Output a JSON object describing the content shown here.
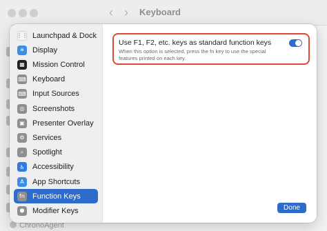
{
  "window": {
    "title": "Keyboard",
    "back_glyph": "‹",
    "forward_glyph": "›",
    "footer_text": "ChronoAgent"
  },
  "sidebar": {
    "items": [
      {
        "label": "Launchpad & Dock",
        "icon": "launchpad-icon",
        "color": "#f4f4f4",
        "glyph": "⋮⋮"
      },
      {
        "label": "Display",
        "icon": "display-icon",
        "color": "#3a8ee6",
        "glyph": "☀"
      },
      {
        "label": "Mission Control",
        "icon": "mission-control-icon",
        "color": "#1f1f1f",
        "glyph": "▦"
      },
      {
        "label": "Keyboard",
        "icon": "keyboard-icon",
        "color": "#8e8e93",
        "glyph": "⌨"
      },
      {
        "label": "Input Sources",
        "icon": "input-sources-icon",
        "color": "#8e8e93",
        "glyph": "⌨"
      },
      {
        "label": "Screenshots",
        "icon": "screenshots-icon",
        "color": "#8e8e93",
        "glyph": "◎"
      },
      {
        "label": "Presenter Overlay",
        "icon": "presenter-overlay-icon",
        "color": "#8e8e93",
        "glyph": "▣"
      },
      {
        "label": "Services",
        "icon": "services-icon",
        "color": "#8e8e93",
        "glyph": "⚙"
      },
      {
        "label": "Spotlight",
        "icon": "spotlight-icon",
        "color": "#8e8e93",
        "glyph": "⌕"
      },
      {
        "label": "Accessibility",
        "icon": "accessibility-icon",
        "color": "#2f7be0",
        "glyph": "♿"
      },
      {
        "label": "App Shortcuts",
        "icon": "app-shortcuts-icon",
        "color": "#3a8ee6",
        "glyph": "A"
      },
      {
        "label": "Function Keys",
        "icon": "function-keys-icon",
        "color": "#8e8e93",
        "glyph": "fn",
        "selected": true
      },
      {
        "label": "Modifier Keys",
        "icon": "modifier-keys-icon",
        "color": "#8e8e93",
        "glyph": "⬢"
      }
    ]
  },
  "main": {
    "option": {
      "title": "Use F1, F2, etc. keys as standard function keys",
      "description": "When this option is selected, press the fn key to use the special features printed on each key.",
      "toggle_on": true
    },
    "done_label": "Done"
  },
  "colors": {
    "accent": "#2e6ccc",
    "highlight_border": "#e0482f"
  }
}
